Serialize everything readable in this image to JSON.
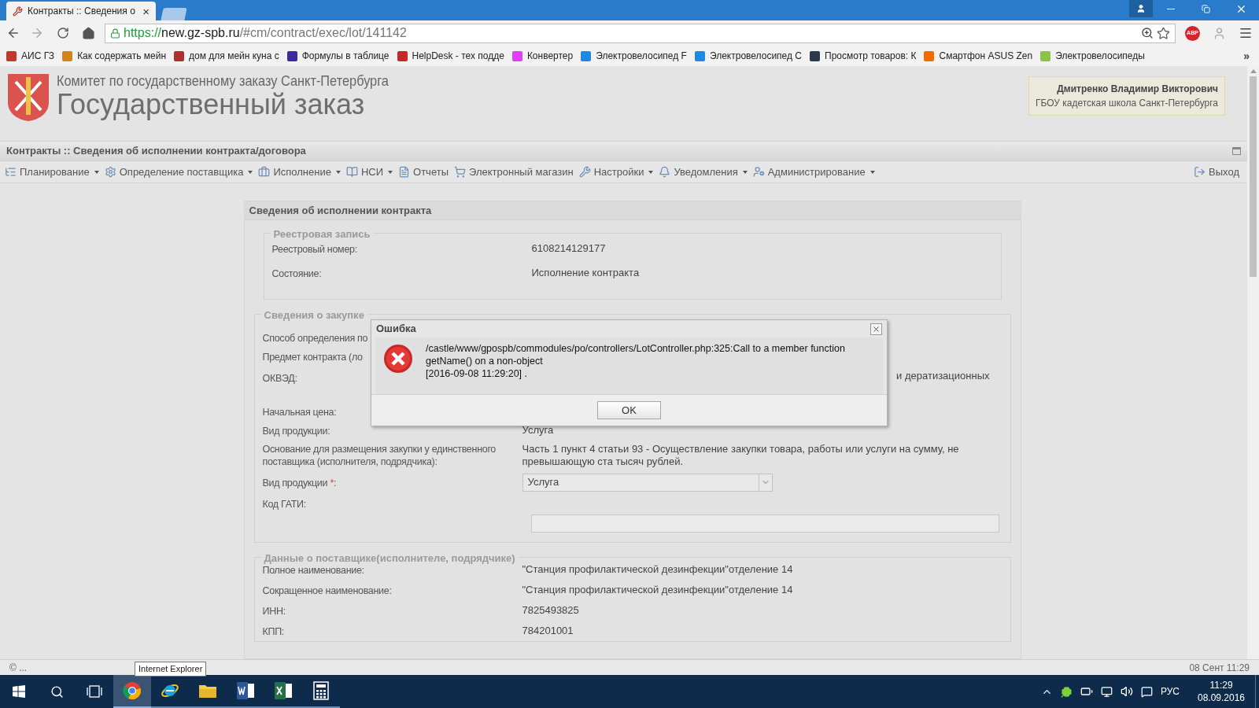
{
  "browser": {
    "tab_title": "Контракты :: Сведения о",
    "tab_close": "×",
    "url": {
      "scheme": "https://",
      "host": "new.gz-spb.ru",
      "path": "/#cm/contract/exec/lot/141142"
    },
    "extension": "ABP",
    "bookmarks": [
      "АИС ГЗ",
      "Как содержать мейн",
      "дом для мейн куна с",
      "Формулы в таблице",
      "HelpDesk - тех подде",
      "Конвертер",
      "Электровелосипед F",
      "Электровелосипед C",
      "Просмотр товаров: К",
      "Смартфон ASUS Zen",
      "Электровелосипеды"
    ],
    "more": "»"
  },
  "header": {
    "organization": "Комитет по государственному заказу Санкт-Петербурга",
    "title": "Государственный заказ",
    "user_name": "Дмитренко Владимир Викторович",
    "user_org": "ГБОУ кадетская школа Санкт-Петербурга"
  },
  "page_title": "Контракты :: Сведения об исполнении контракта/договора",
  "menu": [
    {
      "label": "Планирование",
      "dropdown": true
    },
    {
      "label": "Определение поставщика",
      "dropdown": true
    },
    {
      "label": "Исполнение",
      "dropdown": true
    },
    {
      "label": "НСИ",
      "dropdown": true
    },
    {
      "label": "Отчеты",
      "dropdown": false
    },
    {
      "label": "Электронный магазин",
      "dropdown": false
    },
    {
      "label": "Настройки",
      "dropdown": true
    },
    {
      "label": "Уведомления",
      "dropdown": true
    },
    {
      "label": "Администрирование",
      "dropdown": true
    }
  ],
  "exit": "Выход",
  "panel": {
    "title": "Сведения об исполнении контракта",
    "sections": [
      {
        "legend": "Реестровая запись",
        "rows": [
          {
            "kind": "text",
            "label": "Реестровый номер:",
            "value": "6108214129177"
          },
          {
            "kind": "text",
            "label": "Состояние:",
            "value": "Исполнение контракта"
          }
        ]
      },
      {
        "legend": "Сведения о закупке",
        "rows": [
          {
            "kind": "text",
            "label": "Способ определения по"
          },
          {
            "kind": "text",
            "label": "Предмет контракта (ло"
          },
          {
            "kind": "tail",
            "label": "ОКВЭД:",
            "value": "и дератизационных"
          },
          {
            "kind": "text",
            "label": "Начальная цена:"
          },
          {
            "kind": "text",
            "label": "Вид продукции:",
            "value": "Услуга"
          },
          {
            "kind": "text",
            "label": "Основание для размещения закупки у единственного поставщика (исполнителя, подрядчика):",
            "value": "Часть 1 пункт 4 статьи 93 - Осуществление закупки товара, работы или услуги на сумму, не превышающую ста тысяч рублей."
          },
          {
            "kind": "select",
            "label": "Вид продукции",
            "required_mark": "*",
            "label_suffix": ":",
            "value": "Услуга"
          },
          {
            "kind": "input",
            "label": "Код ГАТИ:"
          }
        ]
      },
      {
        "legend": "Данные о поставщике(исполнителе, подрядчике)",
        "rows": [
          {
            "kind": "text",
            "label": "Полное наименование:",
            "value": "\"Станция профилактической дезинфекции\"отделение 14"
          },
          {
            "kind": "text",
            "label": "Сокращенное наименование:",
            "value": "\"Станция профилактической дезинфекции\"отделение 14"
          },
          {
            "kind": "text",
            "label": "ИНН:",
            "value": "7825493825"
          },
          {
            "kind": "text",
            "label": "КПП:",
            "value": "784201001"
          }
        ]
      }
    ]
  },
  "dialog": {
    "title": "Ошибка",
    "lines": [
      "/castle/www/gpospb/commodules/po/controllers/LotController.php:325:Call to a member function",
      "getName() on a non-object",
      "[2016-09-08 11:29:20] ."
    ],
    "button": "OK"
  },
  "status_bar": {
    "left": "© ...",
    "right": "08 Сент 11:29"
  },
  "tooltip": "Internet Explorer",
  "taskbar": {
    "apps": [
      {
        "kind": "chrome",
        "active": true
      },
      {
        "kind": "ie",
        "active": false
      },
      {
        "kind": "explorer",
        "active": false
      },
      {
        "kind": "word",
        "active": false
      },
      {
        "kind": "excel",
        "active": false
      },
      {
        "kind": "calculator",
        "active": false
      }
    ],
    "language": "РУС",
    "time": "11:29",
    "date": "08.09.2016"
  }
}
